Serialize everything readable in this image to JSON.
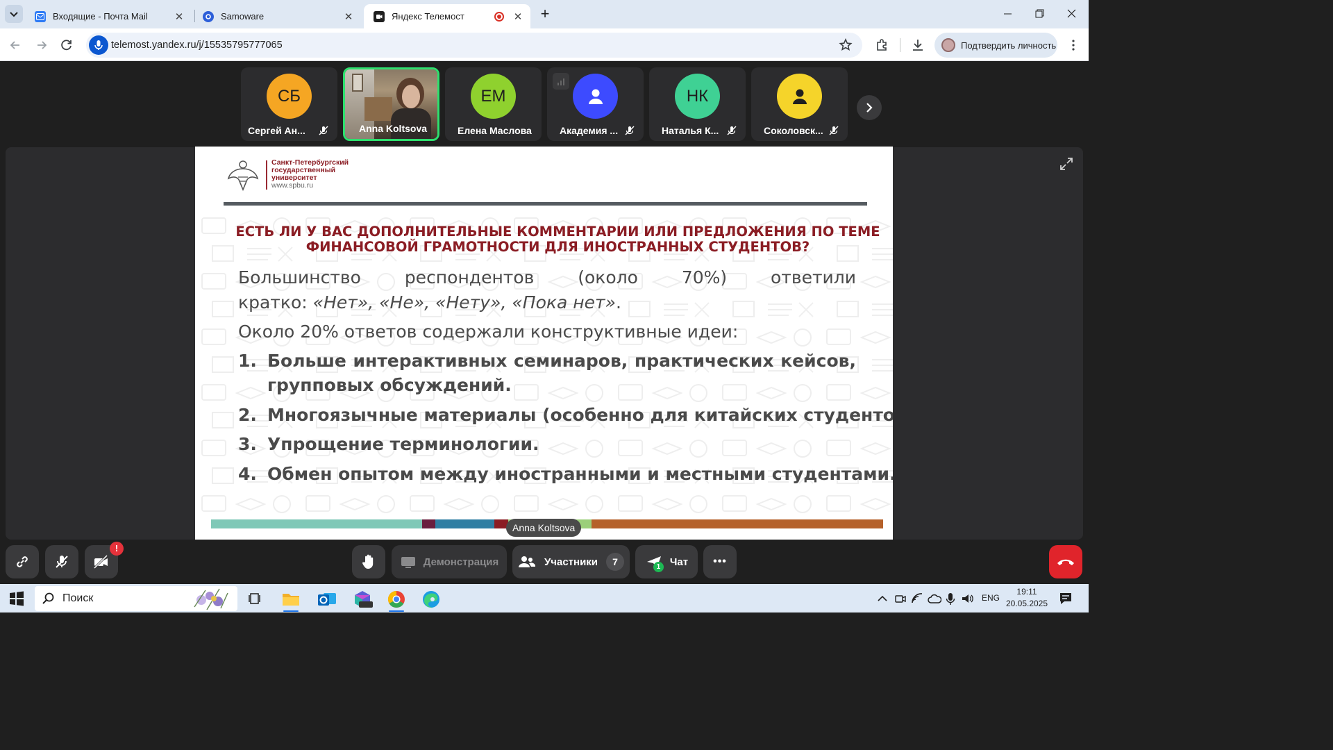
{
  "browser": {
    "tabs": [
      {
        "title": "Входящие - Почта Mail",
        "active": false
      },
      {
        "title": "Samoware",
        "active": false
      },
      {
        "title": "Яндекс Телемост",
        "active": true
      }
    ],
    "url": "telemost.yandex.ru/j/15535795777065",
    "verify_label": "Подтвердить личность"
  },
  "participants": [
    {
      "initials": "СБ",
      "name": "Сергей Ан...",
      "color": "#f5a623",
      "muted": true
    },
    {
      "initials": "",
      "name": "Anna Koltsova",
      "color": "#6b5a48",
      "muted": false,
      "video": true
    },
    {
      "initials": "ЕМ",
      "name": "Елена Маслова",
      "color": "#8fd12e",
      "muted": false
    },
    {
      "initials": "",
      "name": "Академия ...",
      "color": "#3d4bff",
      "muted": true,
      "person_icon": true
    },
    {
      "initials": "НК",
      "name": "Наталья К...",
      "color": "#3fd194",
      "muted": true
    },
    {
      "initials": "",
      "name": "Соколовск...",
      "color": "#f5d42a",
      "muted": true,
      "person_icon": true
    }
  ],
  "slide": {
    "university": [
      "Санкт-Петербургский",
      "государственный",
      "университет",
      "www.spbu.ru"
    ],
    "heading_line1": "ЕСТЬ ЛИ У ВАС ДОПОЛНИТЕЛЬНЫЕ КОММЕНТАРИИ ИЛИ ПРЕДЛОЖЕНИЯ ПО ТЕМЕ",
    "heading_line2": "ФИНАНСОВОЙ ГРАМОТНОСТИ ДЛЯ ИНОСТРАННЫХ СТУДЕНТОВ?",
    "para1_words": [
      "Большинство",
      "респондентов",
      "(около",
      "70%)",
      "ответили"
    ],
    "para1_line2_prefix": "кратко: ",
    "para1_line2_italic": "«Нет», «Не», «Нету», «Пока нет»",
    "para1_line2_suffix": ".",
    "para2": "Около 20% ответов содержали конструктивные идеи:",
    "list": [
      {
        "num": "1.",
        "words": [
          "Больше",
          "интерактивных",
          "семинаров,",
          "практических",
          "кейсов,"
        ],
        "cont": "групповых обсуждений."
      },
      {
        "num": "2.",
        "text": "Многоязычные материалы (особенно для китайских студентов)."
      },
      {
        "num": "3.",
        "text": "Упрощение терминологии."
      },
      {
        "num": "4.",
        "text": "Обмен опытом между иностранными и местными студентами."
      }
    ],
    "speaker_label": "Anna Koltsova"
  },
  "controls": {
    "alert_badge": "!",
    "raise_hand": "",
    "demo_label": "Демонстрация",
    "participants_label": "Участники",
    "participants_count": "7",
    "chat_label": "Чат",
    "chat_badge": "1",
    "more": "•••"
  },
  "taskbar": {
    "search_label": "Поиск",
    "lang": "ENG",
    "time": "19:11",
    "date": "20.05.2025"
  },
  "colors": {
    "slide_heading": "#8b1d24",
    "slide_text": "#4a4a4a",
    "active_tile_border": "#2ee06e",
    "hangup": "#e0242b"
  }
}
